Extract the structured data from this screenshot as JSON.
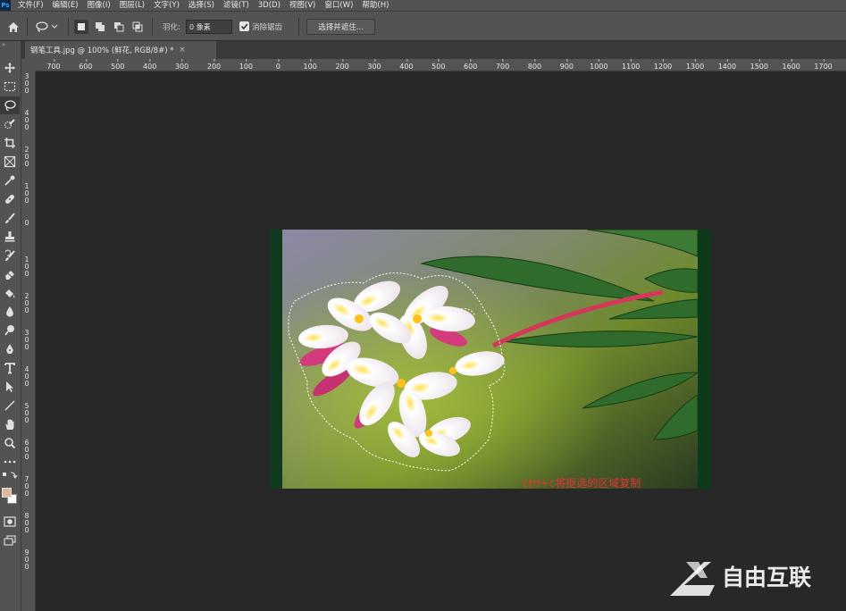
{
  "menubar": {
    "app_logo": "Ps",
    "items": [
      "文件(F)",
      "编辑(E)",
      "图像(I)",
      "图层(L)",
      "文字(Y)",
      "选择(S)",
      "滤镜(T)",
      "3D(D)",
      "视图(V)",
      "窗口(W)",
      "帮助(H)"
    ]
  },
  "options": {
    "feather_label": "羽化:",
    "feather_value": "0 像素",
    "anti_alias_label": "消除锯齿",
    "anti_alias_checked": true,
    "select_and_mask": "选择并遮住..."
  },
  "document_tab": {
    "title": "钢笔工具.jpg @ 100% (鲜花, RGB/8#) *",
    "close": "×"
  },
  "ruler_h": {
    "ticks": [
      "700",
      "600",
      "500",
      "400",
      "300",
      "200",
      "100",
      "0",
      "100",
      "200",
      "300",
      "400",
      "500",
      "600",
      "700",
      "800",
      "900",
      "1000",
      "1100",
      "1200",
      "1300",
      "1400",
      "1500",
      "1600",
      "1700"
    ]
  },
  "ruler_v": {
    "ticks": [
      "300",
      "400",
      "200",
      "100",
      "0",
      "100",
      "200",
      "300",
      "400",
      "500",
      "600",
      "700",
      "800",
      "900"
    ]
  },
  "tools": [
    "move-tool",
    "marquee-tool",
    "lasso-tool",
    "quick-select-tool",
    "crop-tool",
    "frame-tool",
    "eyedropper-tool",
    "healing-tool",
    "brush-tool",
    "clone-stamp-tool",
    "history-brush-tool",
    "eraser-tool",
    "paint-bucket-tool",
    "blur-tool",
    "dodge-tool",
    "pen-tool",
    "type-tool",
    "path-select-tool",
    "line-tool",
    "hand-tool",
    "zoom-tool",
    "more-tools"
  ],
  "colors": {
    "foreground": "#e1b79b",
    "background": "#ffffff",
    "caption": "#e8303a"
  },
  "caption": "ctrl+c将抠选的区域复制",
  "watermark": {
    "text": "自由互联"
  }
}
